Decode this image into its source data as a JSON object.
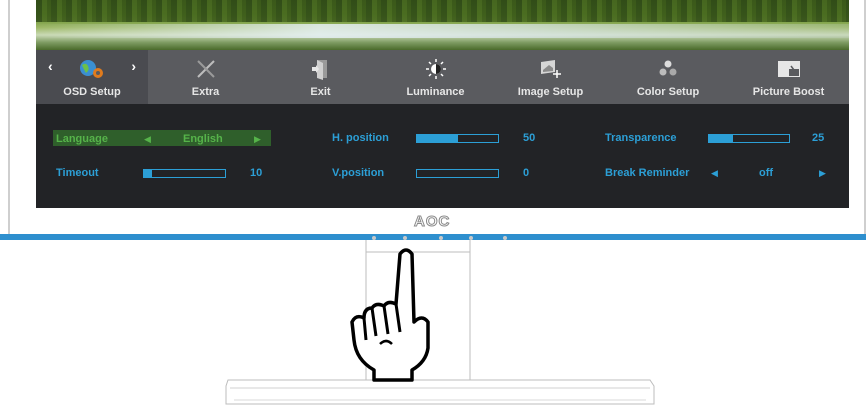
{
  "tabs": [
    {
      "label": "OSD Setup",
      "icon": "globe-gear-icon"
    },
    {
      "label": "Extra",
      "icon": "tools-icon"
    },
    {
      "label": "Exit",
      "icon": "exit-door-icon"
    },
    {
      "label": "Luminance",
      "icon": "sun-icon"
    },
    {
      "label": "Image Setup",
      "icon": "image-setup-icon"
    },
    {
      "label": "Color Setup",
      "icon": "color-dots-icon"
    },
    {
      "label": "Picture Boost",
      "icon": "picture-boost-icon"
    }
  ],
  "settings": {
    "language": {
      "label": "Language",
      "value": "English"
    },
    "timeout": {
      "label": "Timeout",
      "value": "10",
      "level": 0.1
    },
    "h_position": {
      "label": "H. position",
      "value": "50",
      "level": 0.5
    },
    "v_position": {
      "label": "V.position",
      "value": "0",
      "level": 0.0
    },
    "transparence": {
      "label": "Transparence",
      "value": "25",
      "level": 0.3
    },
    "break_reminder": {
      "label": "Break Reminder",
      "value": "off"
    }
  },
  "brand": "AOC",
  "colors": {
    "accent": "#2c9fd6",
    "highlight": "#56b34a",
    "bar": "#2e8fce"
  }
}
